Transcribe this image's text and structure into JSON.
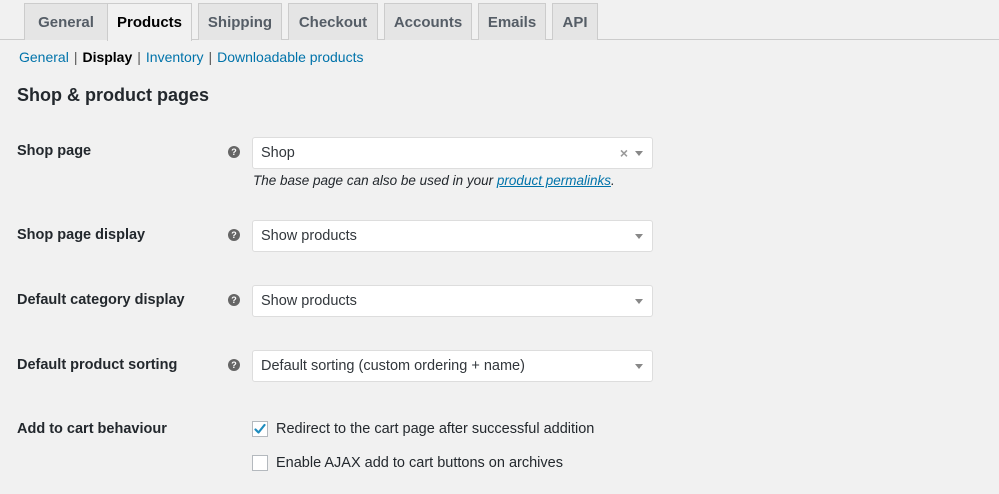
{
  "tabs": [
    {
      "label": "General"
    },
    {
      "label": "Products"
    },
    {
      "label": "Shipping"
    },
    {
      "label": "Checkout"
    },
    {
      "label": "Accounts"
    },
    {
      "label": "Emails"
    },
    {
      "label": "API"
    }
  ],
  "active_tab": "Products",
  "subnav": {
    "general": "General",
    "display": "Display",
    "inventory": "Inventory",
    "downloadable": "Downloadable products",
    "separator": "|"
  },
  "section_title": "Shop & product pages",
  "fields": {
    "shop_page": {
      "label": "Shop page",
      "value": "Shop",
      "clear": "×",
      "description_prefix": "The base page can also be used in your ",
      "description_link": "product permalinks",
      "description_suffix": "."
    },
    "shop_page_display": {
      "label": "Shop page display",
      "value": "Show products"
    },
    "default_category_display": {
      "label": "Default category display",
      "value": "Show products"
    },
    "default_product_sorting": {
      "label": "Default product sorting",
      "value": "Default sorting (custom ordering + name)"
    },
    "add_to_cart": {
      "label": "Add to cart behaviour",
      "options": [
        {
          "label": "Redirect to the cart page after successful addition",
          "checked": true
        },
        {
          "label": "Enable AJAX add to cart buttons on archives",
          "checked": false
        }
      ]
    }
  },
  "help_glyph": "?",
  "colors": {
    "link": "#0073aa",
    "checkmark": "#1e8cbe",
    "background": "#f1f1f1"
  }
}
